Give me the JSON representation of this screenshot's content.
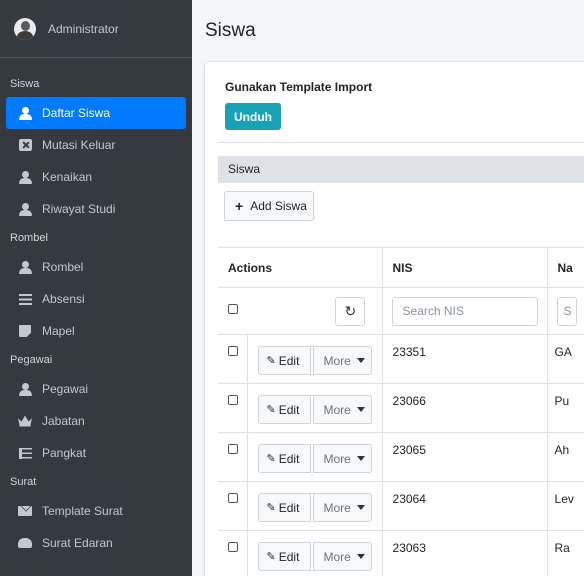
{
  "sidebar": {
    "user_name": "Administrator",
    "sections": [
      {
        "header": "Siswa",
        "items": [
          {
            "label": "Daftar Siswa",
            "icon": "user-icon",
            "active": true
          },
          {
            "label": "Mutasi Keluar",
            "icon": "x-box-icon"
          },
          {
            "label": "Kenaikan",
            "icon": "user-icon"
          },
          {
            "label": "Riwayat Studi",
            "icon": "user-icon"
          }
        ]
      },
      {
        "header": "Rombel",
        "items": [
          {
            "label": "Rombel",
            "icon": "user-icon"
          },
          {
            "label": "Absensi",
            "icon": "list-icon"
          },
          {
            "label": "Mapel",
            "icon": "note-icon"
          }
        ]
      },
      {
        "header": "Pegawai",
        "items": [
          {
            "label": "Pegawai",
            "icon": "user-icon"
          },
          {
            "label": "Jabatan",
            "icon": "crown-icon"
          },
          {
            "label": "Pangkat",
            "icon": "tasks-icon"
          }
        ]
      },
      {
        "header": "Surat",
        "items": [
          {
            "label": "Template Surat",
            "icon": "envelope-icon"
          },
          {
            "label": "Surat Edaran",
            "icon": "cloud-icon"
          }
        ]
      }
    ],
    "active_color": "#007bff",
    "bg_color": "#343a40"
  },
  "main": {
    "page_title": "Siswa",
    "import_title": "Gunakan Template Import",
    "unduh_label": "Unduh",
    "unduh_color": "#17a2b8",
    "section_label": "Siswa",
    "add_label": "Add Siswa",
    "table": {
      "headers": {
        "actions": "Actions",
        "nis": "NIS",
        "nama": "Na"
      },
      "search_nis_placeholder": "Search NIS",
      "search_nama_placeholder": "S",
      "edit_label": "Edit",
      "more_label": "More",
      "rows": [
        {
          "nis": "23351",
          "nama": "GA"
        },
        {
          "nis": "23066",
          "nama": "Pu"
        },
        {
          "nis": "23065",
          "nama": "Ah"
        },
        {
          "nis": "23064",
          "nama": "Lev"
        },
        {
          "nis": "23063",
          "nama": "Ra"
        }
      ]
    }
  }
}
